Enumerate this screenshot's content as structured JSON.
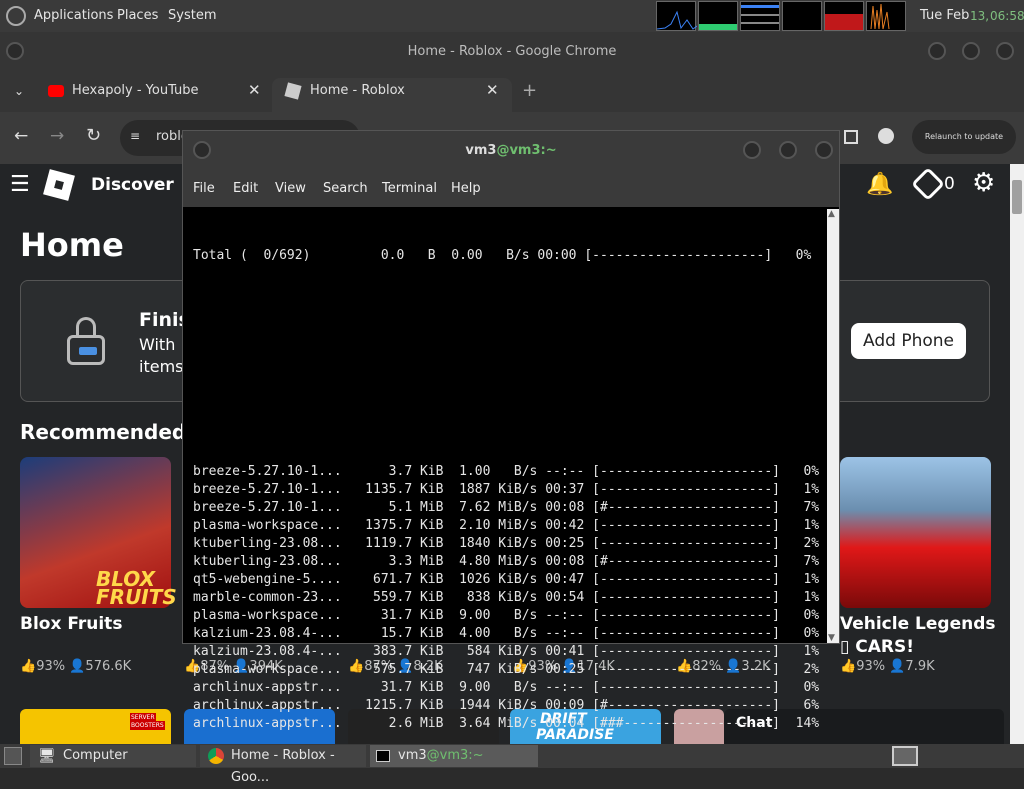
{
  "top_panel": {
    "applications": "Applications",
    "places": "Places",
    "system": "System",
    "clock_day": "Tue Feb",
    "clock_date": "13,",
    "clock_time": "06:58"
  },
  "chrome": {
    "window_title": "Home - Roblox - Google Chrome",
    "tabs": [
      {
        "label": "Hexapoly - YouTube"
      },
      {
        "label": "Home - Roblox"
      }
    ],
    "omnibox_text": "roblo",
    "relaunch_label": "Relaunch to update"
  },
  "roblox": {
    "nav_title": "Discover",
    "robux_count": "0",
    "heading": "Home",
    "banner_title": "Finis",
    "banner_line1": "With",
    "banner_line2": "items",
    "add_phone": "Add Phone",
    "recommended": "Recommended",
    "games": [
      {
        "name": "Blox Fruits",
        "rating": "93%",
        "players": "576.6K",
        "colors": [
          "#1c3d7a",
          "#c0392b"
        ]
      },
      {
        "name": "",
        "rating": "87%",
        "players": "394K",
        "colors": [
          "#3a3a3a",
          "#555"
        ]
      },
      {
        "name": "",
        "rating": "87%",
        "players": "8.2K",
        "colors": [
          "#3a3a3a",
          "#555"
        ]
      },
      {
        "name": "",
        "rating": "93%",
        "players": "17.4K",
        "colors": [
          "#3a3a3a",
          "#555"
        ]
      },
      {
        "name": "",
        "rating": "82%",
        "players": "3.2K",
        "colors": [
          "#3a3a3a",
          "#555"
        ]
      },
      {
        "name": "Vehicle Legends",
        "name2": "CARS!",
        "rating": "93%",
        "players": "7.9K",
        "colors": [
          "#9cc3e6",
          "#e01818"
        ]
      }
    ],
    "bottom_labels": {
      "drift": "DRIFT",
      "paradise": "PARADISE",
      "server": "SERVER",
      "boosters": "BOOSTERS"
    },
    "chat": "Chat"
  },
  "terminal": {
    "title_user": "vm3",
    "title_host": "@vm3",
    "title_path": ":~",
    "menu": [
      "File",
      "Edit",
      "View",
      "Search",
      "Terminal",
      "Help"
    ],
    "total_line": "Total (  0/692)         0.0   B  0.00   B/s 00:00 [----------------------]   0%",
    "lines": [
      "breeze-5.27.10-1...      3.7 KiB  1.00   B/s --:-- [----------------------]   0%",
      "breeze-5.27.10-1...   1135.7 KiB  1887 KiB/s 00:37 [----------------------]   1%",
      "breeze-5.27.10-1...      5.1 MiB  7.62 MiB/s 00:08 [#---------------------]   7%",
      "plasma-workspace...   1375.7 KiB  2.10 MiB/s 00:42 [----------------------]   1%",
      "ktuberling-23.08...   1119.7 KiB  1840 KiB/s 00:25 [----------------------]   2%",
      "ktuberling-23.08...      3.3 MiB  4.80 MiB/s 00:08 [#---------------------]   7%",
      "qt5-webengine-5....    671.7 KiB  1026 KiB/s 00:47 [----------------------]   1%",
      "marble-common-23...    559.7 KiB   838 KiB/s 00:54 [----------------------]   1%",
      "plasma-workspace...     31.7 KiB  9.00   B/s --:-- [----------------------]   0%",
      "kalzium-23.08.4-...     15.7 KiB  4.00   B/s --:-- [----------------------]   0%",
      "kalzium-23.08.4-...    383.7 KiB   584 KiB/s 00:41 [----------------------]   1%",
      "plasma-workspace...    575.7 KiB   747 KiB/s 00:25 [----------------------]   2%",
      "archlinux-appstr...     31.7 KiB  9.00   B/s --:-- [----------------------]   0%",
      "archlinux-appstr...   1215.7 KiB  1944 KiB/s 00:09 [#---------------------]   6%",
      "archlinux-appstr...      2.6 MiB  3.64 MiB/s 00:04 [###-------------------]  14%"
    ]
  },
  "taskbar": {
    "computer": "Computer",
    "chrome": "Home - Roblox - Goo...",
    "term_user": "vm3",
    "term_host": "@vm3",
    "term_path": ":~"
  }
}
